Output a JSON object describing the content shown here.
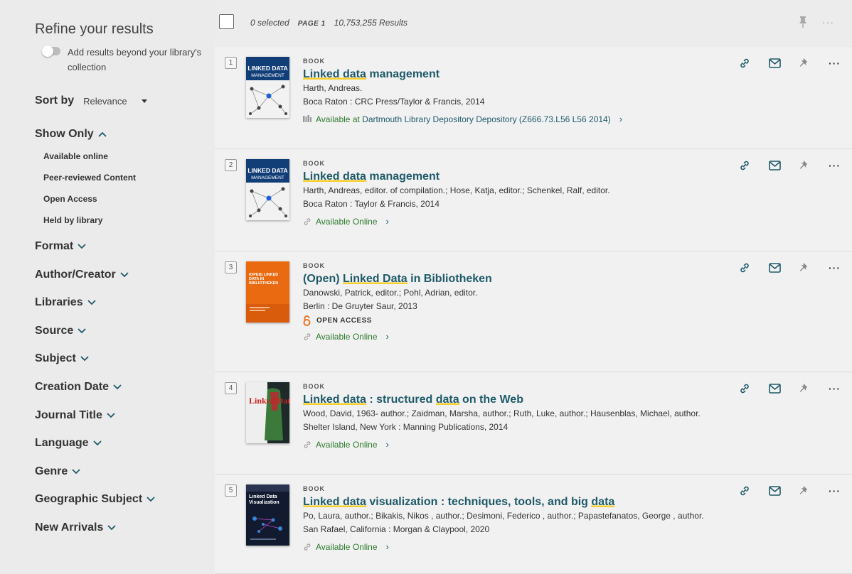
{
  "sidebar": {
    "title": "Refine your results",
    "toggle_label": "Add results beyond your library's collection",
    "sort_label": "Sort by",
    "sort_value": "Relevance",
    "show_only": {
      "label": "Show Only",
      "items": [
        "Available online",
        "Peer-reviewed Content",
        "Open Access",
        "Held by library"
      ]
    },
    "facets": [
      "Format",
      "Author/Creator",
      "Libraries",
      "Source",
      "Subject",
      "Creation Date",
      "Journal Title",
      "Language",
      "Genre",
      "Geographic Subject",
      "New Arrivals"
    ]
  },
  "topbar": {
    "selected": "0 selected",
    "page": "PAGE 1",
    "results": "10,753,255 Results",
    "more": "···"
  },
  "results": [
    {
      "num": "1",
      "type": "BOOK",
      "title_parts": [
        {
          "t": "Linked data",
          "hl": true
        },
        {
          "t": " management",
          "hl": false
        }
      ],
      "author": "Harth, Andreas.",
      "publisher": "Boca Raton : CRC Press/Taylor & Francis, 2014",
      "avail_status": "Available at ",
      "avail_location": "Dartmouth Library Depository  Depository (Z666.73.L56 L56 2014)",
      "cover": "management"
    },
    {
      "num": "2",
      "type": "BOOK",
      "title_parts": [
        {
          "t": "Linked data",
          "hl": true
        },
        {
          "t": " management",
          "hl": false
        }
      ],
      "author": "Harth, Andreas, editor. of compilation.; Hose, Katja, editor.; Schenkel, Ralf, editor.",
      "publisher": "Boca Raton : Taylor & Francis, 2014",
      "avail_status": "Available Online"
    },
    {
      "num": "3",
      "type": "BOOK",
      "title_parts": [
        {
          "t": "(Open) ",
          "hl": false
        },
        {
          "t": "Linked Data",
          "hl": true
        },
        {
          "t": " in Bibliotheken",
          "hl": false
        }
      ],
      "author": "Danowski, Patrick, editor.; Pohl, Adrian, editor.",
      "publisher": "Berlin : De Gruyter Saur, 2013",
      "open_access": "OPEN ACCESS",
      "avail_status": "Available Online"
    },
    {
      "num": "4",
      "type": "BOOK",
      "title_parts": [
        {
          "t": "Linked data",
          "hl": true
        },
        {
          "t": " : structured ",
          "hl": false
        },
        {
          "t": "data",
          "hl": true
        },
        {
          "t": " on the Web",
          "hl": false
        }
      ],
      "author": "Wood, David, 1963- author.; Zaidman, Marsha, author.; Ruth, Luke, author.; Hausenblas, Michael, author.",
      "publisher": "Shelter Island, New York : Manning Publications, 2014",
      "avail_status": "Available Online"
    },
    {
      "num": "5",
      "type": "BOOK",
      "title_parts": [
        {
          "t": "Linked data",
          "hl": true
        },
        {
          "t": " visualization : techniques, tools, and big ",
          "hl": false
        },
        {
          "t": "data",
          "hl": true
        }
      ],
      "author": "Po, Laura, author.; Bikakis, Nikos , author.; Desimoni, Federico , author.; Papastefanatos, George , author.",
      "publisher": "San Rafael, California : Morgan & Claypool, 2020",
      "avail_status": "Available Online"
    }
  ],
  "covers": {
    "c1_title": "LINKED DATA",
    "c1_sub": "MANAGEMENT",
    "c3_title": "(OPEN) LINKED DATA IN BIBLIOTHEKEN",
    "c4_title": "Linked Data",
    "c5_title": "Linked Data Visualization"
  },
  "colors": {
    "accent": "#1e5a69",
    "available": "#2c7a2c",
    "highlight": "#f6cf30",
    "open_access": "#e87722"
  },
  "action_icons": [
    "link-icon",
    "email-icon",
    "pin-icon",
    "more-icon"
  ]
}
